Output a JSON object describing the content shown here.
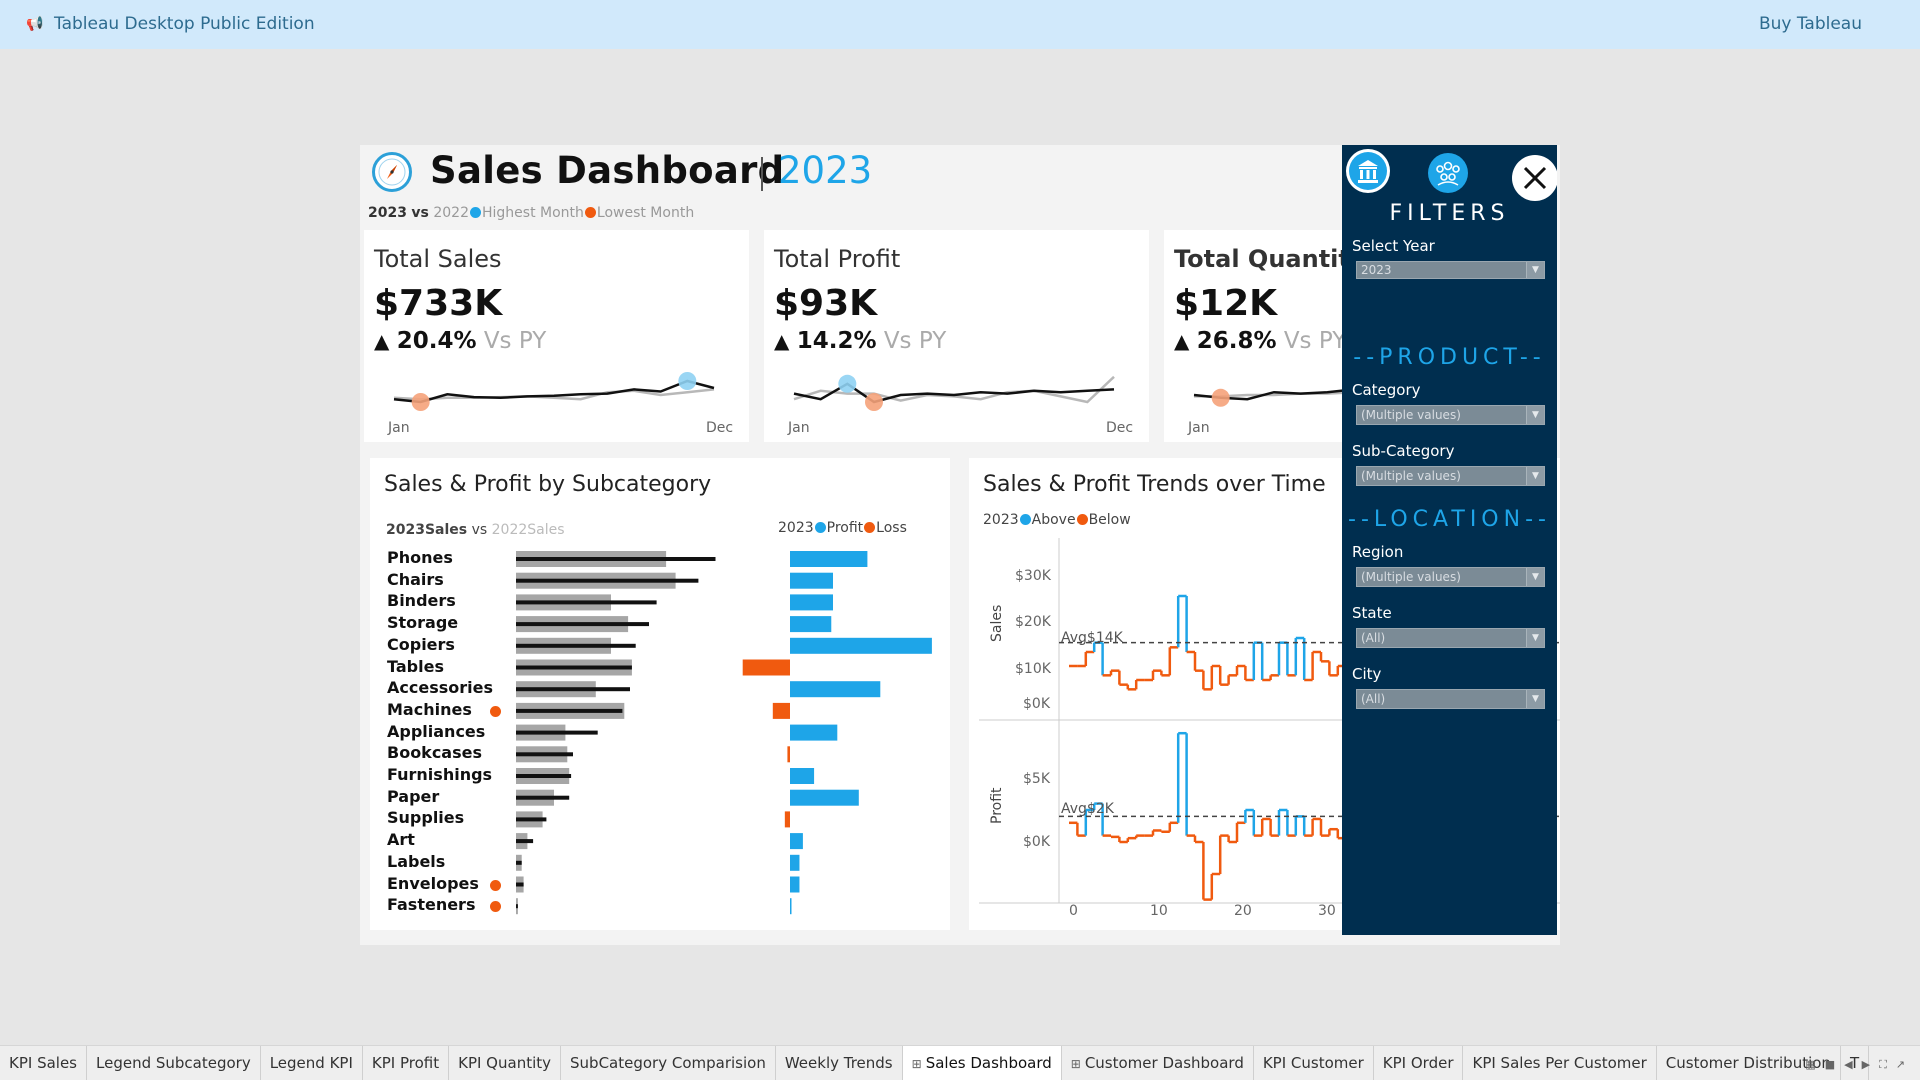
{
  "app": {
    "title": "Tableau Desktop Public Edition",
    "buy_label": "Buy Tableau",
    "megaphone_icon": "megaphone-icon"
  },
  "header": {
    "title": "Sales Dashboard",
    "year": "2023",
    "compass_icon": "compass-icon",
    "comparison": {
      "current": "2023",
      "vs": "vs",
      "previous": "2022",
      "highest": "Highest Month",
      "lowest": "Lowest Month"
    }
  },
  "colors": {
    "accent": "#1ea5e8",
    "negative": "#f05a0f",
    "sidebar": "#002e4f",
    "bar_prev": "#a6a6a6",
    "bar_curr": "#111111"
  },
  "kpis": [
    {
      "title": "Total Sales",
      "value": "$733K",
      "change": "20.4%",
      "vs": "Vs PY",
      "start": "Jan",
      "end": "Dec",
      "current": [
        1.2,
        1.0,
        1.55,
        1.35,
        1.3,
        1.4,
        1.45,
        1.55,
        1.6,
        1.9,
        1.75,
        2.5,
        2.0
      ],
      "previous": [
        1.3,
        1.2,
        1.3,
        1.3,
        1.35,
        1.4,
        1.3,
        1.2,
        1.7,
        1.8,
        1.5,
        1.7,
        1.9
      ],
      "highest": 11,
      "lowest": 1
    },
    {
      "title": "Total Profit",
      "value": "$93K",
      "change": "14.2%",
      "vs": "Vs PY",
      "start": "Jan",
      "end": "Dec",
      "current": [
        1.6,
        1.2,
        2.3,
        1.0,
        1.5,
        1.6,
        1.5,
        1.7,
        1.6,
        1.8,
        1.7,
        1.8,
        1.9
      ],
      "previous": [
        1.2,
        1.8,
        1.6,
        1.6,
        1.1,
        1.5,
        1.4,
        1.2,
        1.7,
        1.8,
        1.4,
        1.0,
        2.8
      ],
      "highest": 2,
      "lowest": 3
    },
    {
      "title": "Total Quantity",
      "value": "$12K",
      "change": "26.8%",
      "vs": "Vs PY",
      "start": "Jan",
      "end": "",
      "current": [
        1.5,
        1.3,
        1.2,
        1.7,
        1.6,
        1.7,
        1.9,
        1.8,
        1.9,
        2.0,
        2.1,
        2.2,
        2.3
      ],
      "previous": [
        1.4,
        1.4,
        1.5,
        1.5,
        1.6,
        1.6,
        1.7,
        1.7,
        1.8,
        1.8,
        1.9,
        2.0,
        2.1
      ],
      "highest": 12,
      "lowest": 1
    }
  ],
  "subcategory_panel": {
    "title": "Sales & Profit by Subcategory",
    "legend_left": {
      "current": "2023",
      "label": "Sales",
      "vs": "vs",
      "previous": "2022",
      "label_prev": "Sales"
    },
    "legend_right": {
      "year": "2023",
      "profit": "Profit",
      "loss": "Loss"
    }
  },
  "trends_panel": {
    "title": "Sales & Profit  Trends over Time",
    "legend": {
      "year": "2023",
      "above": "Above",
      "below": "Below"
    },
    "sales_axis_label": "Sales",
    "profit_axis_label": "Profit",
    "sales_ticks": [
      "$30K",
      "$20K",
      "$10K",
      "$0K"
    ],
    "profit_ticks": [
      "$5K",
      "$0K"
    ],
    "x_ticks": [
      "0",
      "10",
      "20",
      "30"
    ],
    "sales_avg_label": "Avg$14K",
    "profit_avg_label": "Avg$2K"
  },
  "chart_data": [
    {
      "type": "bar",
      "title": "Sales & Profit by Subcategory",
      "categories": [
        "Phones",
        "Chairs",
        "Binders",
        "Storage",
        "Copiers",
        "Tables",
        "Accessories",
        "Machines",
        "Appliances",
        "Bookcases",
        "Furnishings",
        "Paper",
        "Supplies",
        "Art",
        "Labels",
        "Envelopes",
        "Fasteners"
      ],
      "series": [
        {
          "name": "2023 Sales",
          "values": [
            105,
            96,
            74,
            70,
            63,
            61,
            60,
            56,
            43,
            30,
            29,
            28,
            16,
            9,
            3,
            4,
            1
          ]
        },
        {
          "name": "2022 Sales",
          "values": [
            79,
            84,
            50,
            59,
            50,
            61,
            42,
            57,
            26,
            27,
            28,
            20,
            14,
            6,
            3,
            4,
            1
          ]
        },
        {
          "name": "Profit",
          "values": [
            9.0,
            5.0,
            5.0,
            4.8,
            16.5,
            -5.5,
            10.5,
            -2.0,
            5.5,
            -0.3,
            2.8,
            8.0,
            -0.6,
            1.5,
            1.1,
            1.1,
            0.1
          ]
        }
      ],
      "loss_markers": [
        "Machines",
        "Envelopes",
        "Fasteners"
      ]
    },
    {
      "type": "line",
      "title": "Sales & Profit  Trends over Time",
      "x": [
        1,
        2,
        3,
        4,
        5,
        6,
        7,
        8,
        9,
        10,
        11,
        12,
        13,
        14,
        15,
        16,
        17,
        18,
        19,
        20,
        21,
        22,
        23,
        24,
        25,
        26,
        27,
        28,
        29,
        30,
        31,
        32,
        33
      ],
      "series": [
        {
          "name": "Sales",
          "values": [
            9,
            9,
            12,
            14,
            7,
            8,
            5,
            4,
            6,
            6,
            8,
            7,
            13,
            24,
            12,
            8,
            4,
            9,
            5,
            7,
            9,
            6,
            14,
            6,
            7,
            14,
            7,
            15,
            6,
            12,
            10,
            7,
            9
          ]
        },
        {
          "name": "Profit",
          "values": [
            1.5,
            0.5,
            2.5,
            3.0,
            0.5,
            0.4,
            0.0,
            0.3,
            0.5,
            0.5,
            0.9,
            0.8,
            1.5,
            8.5,
            0.5,
            0.0,
            -4.5,
            -2.5,
            0.5,
            0.0,
            1.5,
            2.5,
            0.5,
            1.8,
            0.5,
            2.5,
            0.5,
            2.0,
            0.5,
            1.8,
            0.5,
            1.0,
            0.3
          ]
        }
      ],
      "sales_average": 14,
      "profit_average": 2,
      "ylim_sales": [
        0,
        30
      ],
      "ylim_profit": [
        -5,
        6
      ]
    }
  ],
  "filters": {
    "title": "FILTERS",
    "select_year_label": "Select Year",
    "select_year_value": "2023",
    "product_section": "--PRODUCT--",
    "category_label": "Category",
    "category_value": "(Multiple values)",
    "subcategory_label": "Sub-Category",
    "subcategory_value": "(Multiple values)",
    "location_section": "--LOCATION--",
    "region_label": "Region",
    "region_value": "(Multiple values)",
    "state_label": "State",
    "state_value": "(All)",
    "city_label": "City",
    "city_value": "(All)"
  },
  "tabs": [
    "KPI Sales",
    "Legend Subcategory",
    "Legend KPI",
    "KPI Profit",
    "KPI Quantity",
    "SubCategory Comparision",
    "Weekly Trends",
    "Sales Dashboard",
    "Customer Dashboard",
    "KPI Customer",
    "KPI Order",
    "KPI Sales Per Customer",
    "Customer Distribution",
    "T"
  ],
  "active_tab": "Sales Dashboard",
  "grid_tabs": [
    "Sales Dashboard",
    "Customer Dashboard"
  ]
}
